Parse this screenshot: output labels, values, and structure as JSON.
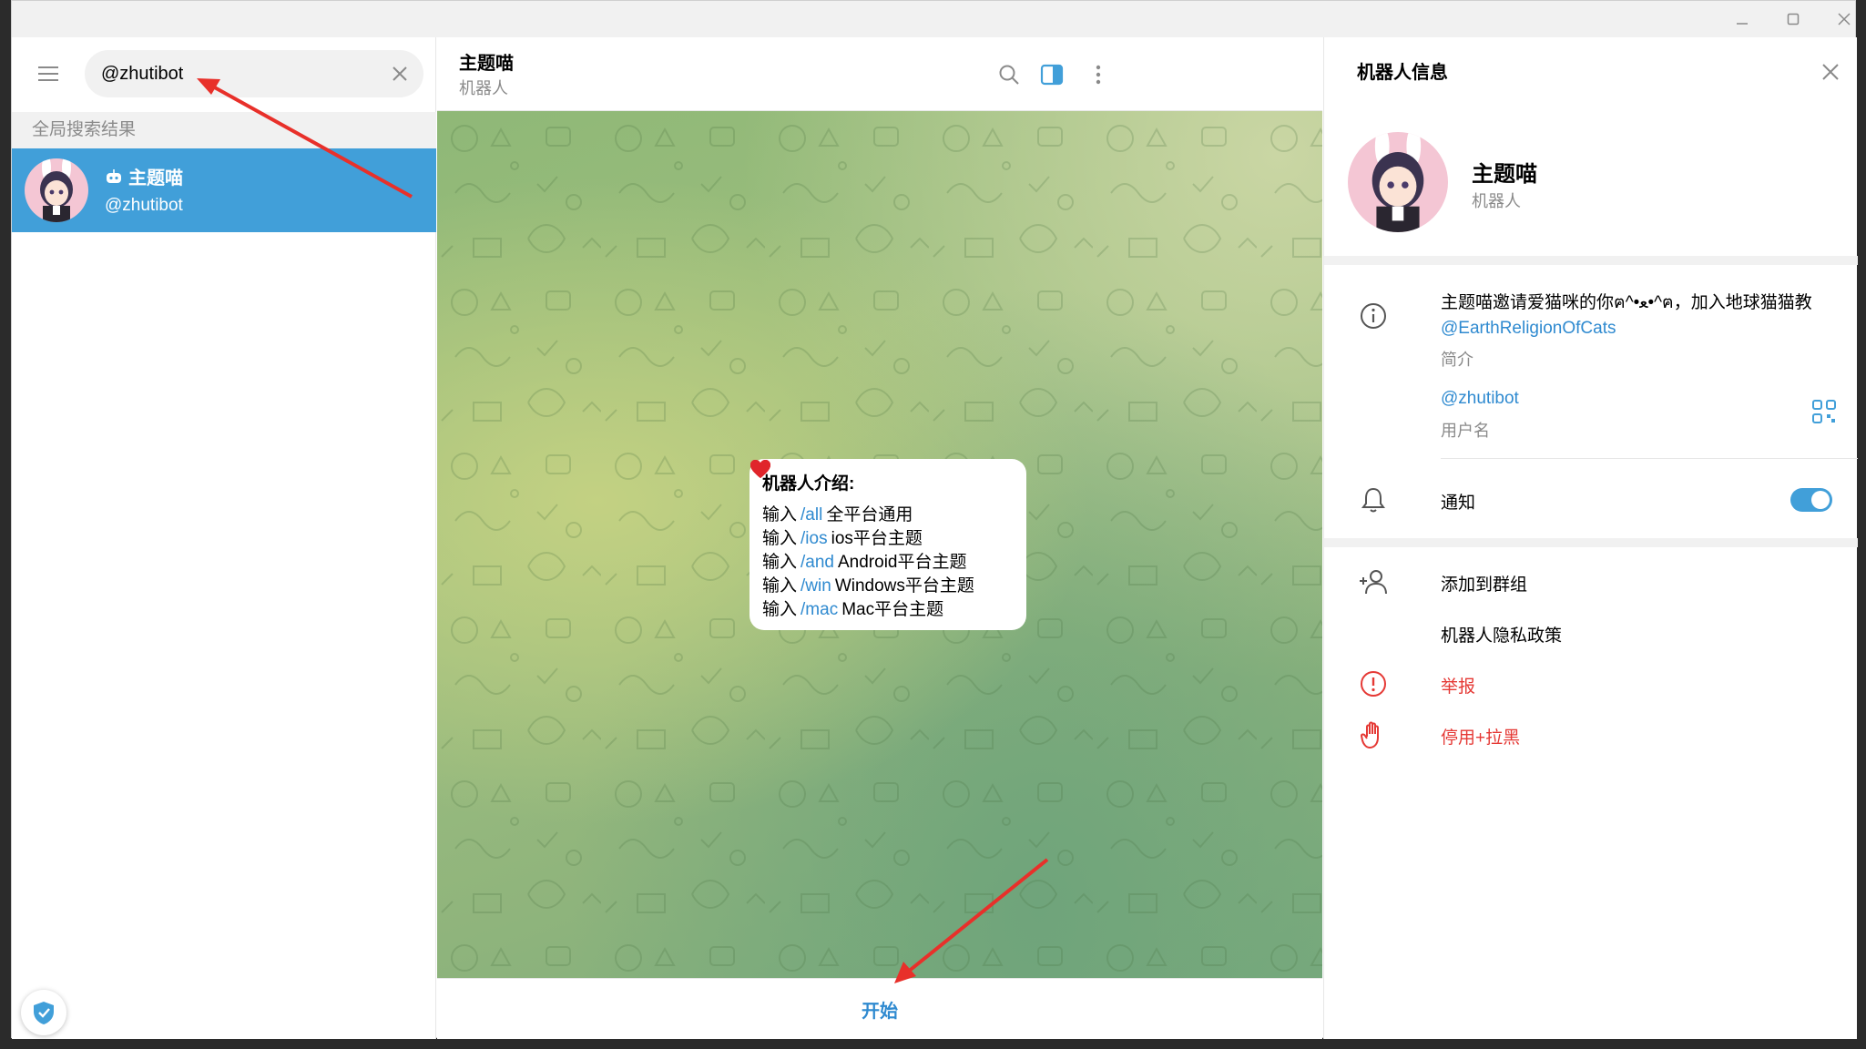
{
  "search": {
    "value": "@zhutibot"
  },
  "left": {
    "section_header": "全局搜索结果",
    "result": {
      "name": "主题喵",
      "handle": "@zhutibot"
    }
  },
  "chat": {
    "title": "主题喵",
    "subtitle": "机器人",
    "intro_title": "机器人介绍:",
    "lines": [
      {
        "prefix": "输入",
        "cmd": "/all",
        "text": "全平台通用"
      },
      {
        "prefix": "输入",
        "cmd": "/ios",
        "text": "ios平台主题"
      },
      {
        "prefix": "输入",
        "cmd": "/and",
        "text": "Android平台主题"
      },
      {
        "prefix": "输入",
        "cmd": "/win",
        "text": "Windows平台主题"
      },
      {
        "prefix": "输入",
        "cmd": "/mac",
        "text": "Mac平台主题"
      }
    ],
    "start_label": "开始"
  },
  "panel": {
    "title": "机器人信息",
    "name": "主题喵",
    "status": "机器人",
    "bio_text": "主题喵邀请爱猫咪的你ฅ^•ﻌ•^ฅ，加入地球猫猫教",
    "bio_link": "@EarthReligionOfCats",
    "bio_label": "简介",
    "username": "@zhutibot",
    "username_label": "用户名",
    "notify_label": "通知",
    "notify_on": true,
    "add_to_group": "添加到群组",
    "privacy_policy": "机器人隐私政策",
    "report": "举报",
    "block": "停用+拉黑"
  },
  "colors": {
    "accent": "#419fd9",
    "link": "#2f8ad0",
    "danger": "#e53935",
    "muted": "#8a8a8a"
  }
}
